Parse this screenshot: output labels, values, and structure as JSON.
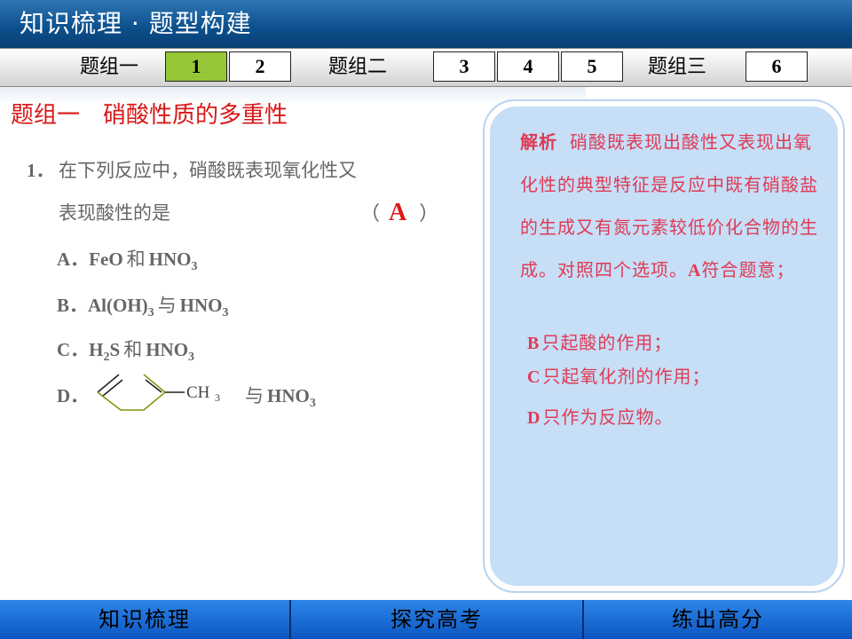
{
  "header": {
    "title": "知识梳理 · 题型构建"
  },
  "nav": {
    "group1_label": "题组一",
    "group2_label": "题组二",
    "group3_label": "题组三",
    "numbers": [
      "1",
      "2",
      "3",
      "4",
      "5",
      "6"
    ],
    "active_number": "1"
  },
  "section": {
    "title": "题组一　硝酸性质的多重性"
  },
  "question": {
    "number": "1．",
    "line1": "在下列反应中，硝酸既表现氧化性又",
    "line2": "表现酸性的是",
    "answer_open": "（",
    "answer": "A",
    "answer_close": "）"
  },
  "options": {
    "A": {
      "prefix": "A．",
      "left": "FeO",
      "join": "和",
      "right_base": "HNO",
      "right_sub": "3"
    },
    "B": {
      "prefix": "B．",
      "left_base": "Al(OH)",
      "left_sub": "3",
      "join": "与",
      "right_base": "HNO",
      "right_sub": "3"
    },
    "C": {
      "prefix": "C．",
      "left_h": "H",
      "left_sub": "2",
      "left_s": "S",
      "join": "和",
      "right_base": "HNO",
      "right_sub": "3"
    },
    "D": {
      "prefix": "D．",
      "ch3_base": "CH",
      "ch3_sub": "3",
      "join": "与",
      "right_base": "HNO",
      "right_sub": "3"
    }
  },
  "analysis": {
    "label": "解析",
    "text_a": "硝酸既表现出酸性又表现出氧化性的典型特征是反应中既有硝酸盐的生成又有氮元素较低价化合物的生成。对照四个选项。",
    "text_a_letter": "A",
    "text_a_end": "符合题意；",
    "line_b_letter": "B",
    "line_b": "只起酸的作用；",
    "line_c_letter": "C",
    "line_c": "只起氧化剂的作用；",
    "line_d_letter": "D",
    "line_d": "只作为反应物。"
  },
  "footer": {
    "buttons": [
      "知识梳理",
      "探究高考",
      "练出高分"
    ]
  },
  "colors": {
    "title_red": "#d81717",
    "analysis_pink": "#e03a55",
    "active_green": "#97c738",
    "panel_blue": "#c6def6",
    "header_blue": "#0b4f8c",
    "footer_blue": "#1a6ee0"
  }
}
